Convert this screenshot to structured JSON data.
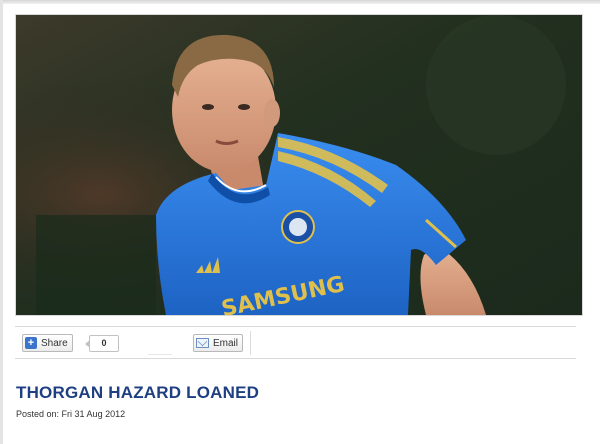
{
  "article": {
    "title": "THORGAN HAZARD LOANED",
    "posted_label": "Posted on:",
    "posted_date": "Fri 31 Aug 2012"
  },
  "photo": {
    "kit_sponsor": "SAMSUNG",
    "shirt_color": "#2f7fdf",
    "sponsor_color": "#e0c04c"
  },
  "share_bar": {
    "share_label": "Share",
    "share_count": "0",
    "email_label": "Email",
    "share_icon": "plus-icon",
    "email_icon": "mail-icon"
  },
  "colors": {
    "headline": "#1e3f82"
  }
}
